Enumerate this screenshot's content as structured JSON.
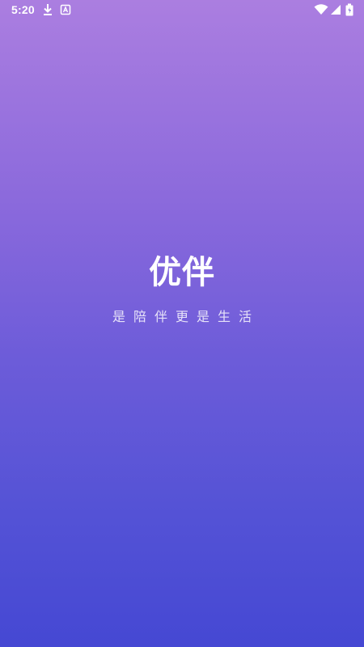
{
  "status_bar": {
    "time": "5:20",
    "icons": [
      "download-icon",
      "app-notification-icon",
      "wifi-icon",
      "cellular-signal-icon",
      "battery-icon"
    ]
  },
  "splash": {
    "app_name": "优伴",
    "slogan": "是陪伴更是生活"
  },
  "colors": {
    "gradient_top": "#ab7ee0",
    "gradient_bottom": "#4548d3",
    "text": "#ffffff"
  }
}
